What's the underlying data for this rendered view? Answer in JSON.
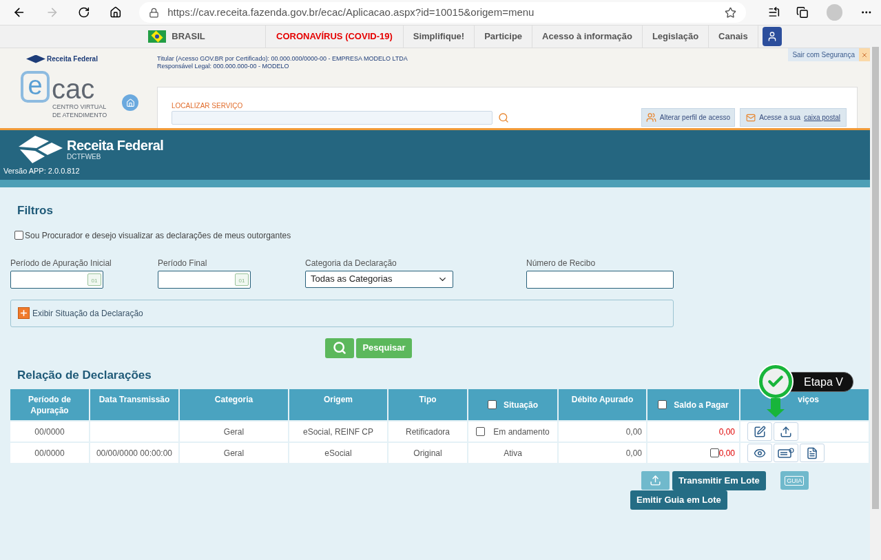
{
  "browser": {
    "url": "https://cav.receita.fazenda.gov.br/ecac/Aplicacao.aspx?id=10015&origem=menu"
  },
  "gov_bar": {
    "country": "BRASIL",
    "links": [
      {
        "label": "CORONAVÍRUS (COVID-19)",
        "highlight": true
      },
      {
        "label": "Simplifique!",
        "highlight": false
      },
      {
        "label": "Participe",
        "highlight": false
      },
      {
        "label": "Acesso à informação",
        "highlight": false
      },
      {
        "label": "Legislação",
        "highlight": false
      },
      {
        "label": "Canais",
        "highlight": false
      }
    ]
  },
  "ecac_header": {
    "brand": "Receita Federal",
    "titular": "Titular (Acesso GOV.BR por Certificado): 00.000.000/0000-00 - EMPRESA MODELO LTDA",
    "responsavel": "Responsável Legal: 000.000.000-00 - MODELO",
    "logout": "Sair com Segurança",
    "logo_letter": "e",
    "logo_word": "cac",
    "logo_line1": "CENTRO VIRTUAL",
    "logo_line2": "DE ATENDIMENTO",
    "search_label": "LOCALIZAR SERVIÇO",
    "profile_button": "Alterar perfil de acesso",
    "mailbox_text": "Acesse a sua",
    "mailbox_link": "caixa postal"
  },
  "app_banner": {
    "brand": "Receita Federal",
    "subtitle": "DCTFWEB",
    "version": "Versão APP: 2.0.0.812"
  },
  "filters": {
    "title": "Filtros",
    "procurador": {
      "label": "Sou Procurador e desejo visualizar as declarações de meus outorgantes",
      "checked": false
    },
    "fields": [
      {
        "kind": "date",
        "label": "Período de Apuração Inicial",
        "calendar_day": "01"
      },
      {
        "kind": "date",
        "label": "Período Final",
        "calendar_day": "01"
      },
      {
        "kind": "select",
        "label": "Categoria da Declaração",
        "value": "Todas as Categorias"
      },
      {
        "kind": "text",
        "label": "Número de Recibo"
      }
    ],
    "expander": {
      "label": "Exibir Situação da Declaração",
      "expanded": false
    },
    "search_button": "Pesquisar"
  },
  "table": {
    "title": "Relação de Declarações",
    "columns": [
      {
        "label": "Período de Apuração"
      },
      {
        "label": "Data Transmissão"
      },
      {
        "label": "Categoria"
      },
      {
        "label": "Origem"
      },
      {
        "label": "Tipo"
      },
      {
        "label": "Situação",
        "checked": false
      },
      {
        "label": "Débito Apurado"
      },
      {
        "label": "Saldo a Pagar",
        "checked": false
      },
      {
        "label": "viços"
      }
    ],
    "rows": [
      {
        "cells": [
          {
            "text": "00/0000"
          },
          {},
          {
            "text": "Geral"
          },
          {
            "text": "eSocial, REINF CP"
          },
          {
            "text": "Retificadora"
          },
          {
            "text": "Em andamento",
            "checked": false
          },
          {
            "text": "0,00"
          },
          {
            "text": "0,00"
          }
        ],
        "actions": [
          {
            "kind": "edit"
          },
          {
            "kind": "upload"
          }
        ]
      },
      {
        "cells": [
          {
            "text": "00/0000"
          },
          {
            "text": "00/00/0000 00:00:00"
          },
          {
            "text": "Geral"
          },
          {
            "text": "eSocial"
          },
          {
            "text": "Original"
          },
          {
            "text": "Ativa"
          },
          {
            "text": "0,00"
          },
          {
            "text": "0,00",
            "checked": false
          }
        ],
        "actions": [
          {
            "kind": "view"
          },
          {
            "kind": "guide"
          },
          {
            "kind": "document"
          }
        ]
      }
    ]
  },
  "callout": {
    "label": "Etapa V"
  },
  "batch": {
    "transmit": "Transmitir Em Lote",
    "guide": "Emitir Guia em Lote",
    "guide_icon": "GUIA"
  }
}
